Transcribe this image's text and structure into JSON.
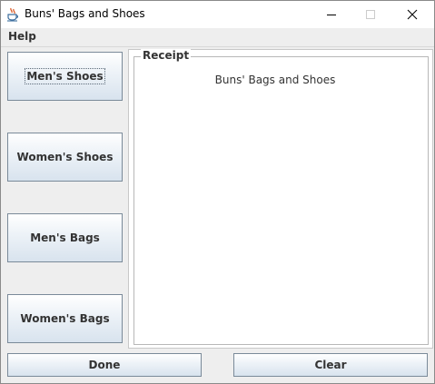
{
  "window": {
    "title": "Buns' Bags and Shoes",
    "icon": "java-cup-icon"
  },
  "menu": {
    "items": [
      {
        "label": "Help"
      }
    ]
  },
  "left_panel": {
    "buttons": [
      {
        "label": "Men's Shoes",
        "focused": true
      },
      {
        "label": "Women's Shoes"
      },
      {
        "label": "Men's Bags"
      },
      {
        "label": "Women's Bags"
      }
    ]
  },
  "receipt": {
    "legend": "Receipt",
    "text": "Buns' Bags and Shoes"
  },
  "footer": {
    "done_label": "Done",
    "clear_label": "Clear"
  },
  "colors": {
    "button_gradient_top": "#ffffff",
    "button_gradient_bottom": "#d8e3ee",
    "button_border": "#7a8a99",
    "window_bg": "#eeeeee"
  }
}
